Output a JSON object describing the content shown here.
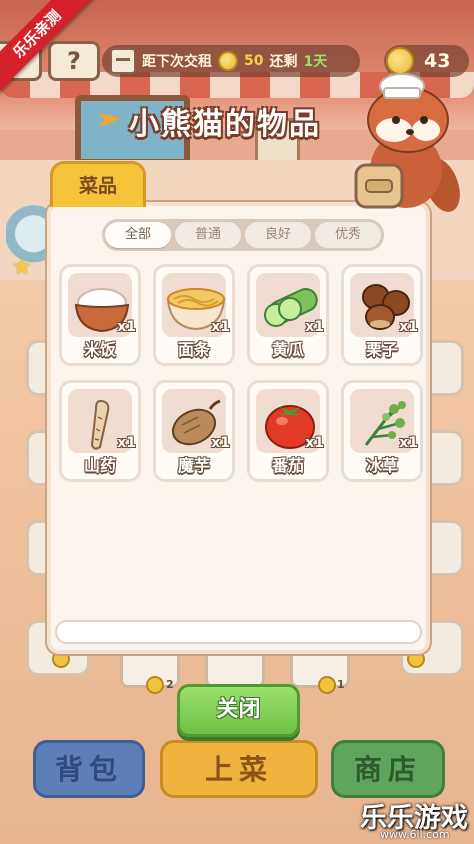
{
  "hud": {
    "corner_badge": "乐乐亲测",
    "help_label": "?",
    "rent_prefix": "距下次交租",
    "rent_amount": "50",
    "rent_mid": "还剩",
    "rent_days": "1天",
    "coins": "43"
  },
  "title": "小熊猫的物品",
  "modal": {
    "tab_label": "菜品",
    "filters": [
      "全部",
      "普通",
      "良好",
      "优秀"
    ],
    "active_filter": "全部",
    "items": [
      {
        "name": "米饭",
        "qty": "x1",
        "icon": "rice-bowl-icon"
      },
      {
        "name": "面条",
        "qty": "x1",
        "icon": "noodles-bowl-icon"
      },
      {
        "name": "黄瓜",
        "qty": "x1",
        "icon": "cucumber-icon"
      },
      {
        "name": "栗子",
        "qty": "x1",
        "icon": "chestnut-icon"
      },
      {
        "name": "山药",
        "qty": "x1",
        "icon": "yam-icon"
      },
      {
        "name": "魔芋",
        "qty": "x1",
        "icon": "konjac-icon"
      },
      {
        "name": "番茄",
        "qty": "x1",
        "icon": "tomato-icon"
      },
      {
        "name": "冰草",
        "qty": "x1",
        "icon": "ice-plant-icon"
      }
    ]
  },
  "background": {
    "counts": [
      "2",
      "1"
    ]
  },
  "buttons": {
    "close": "关闭",
    "bag": "背包",
    "serve": "上菜",
    "shop": "商店"
  },
  "watermark": {
    "main": "乐乐游戏",
    "url": "www.6ll.com"
  },
  "colors": {
    "modal_bg": "#fbf4ec",
    "tab": "#f6c43b",
    "close": "#6fc246",
    "bag": "#5d7fb8",
    "serve": "#f0b43e",
    "shop": "#5fa65c"
  }
}
